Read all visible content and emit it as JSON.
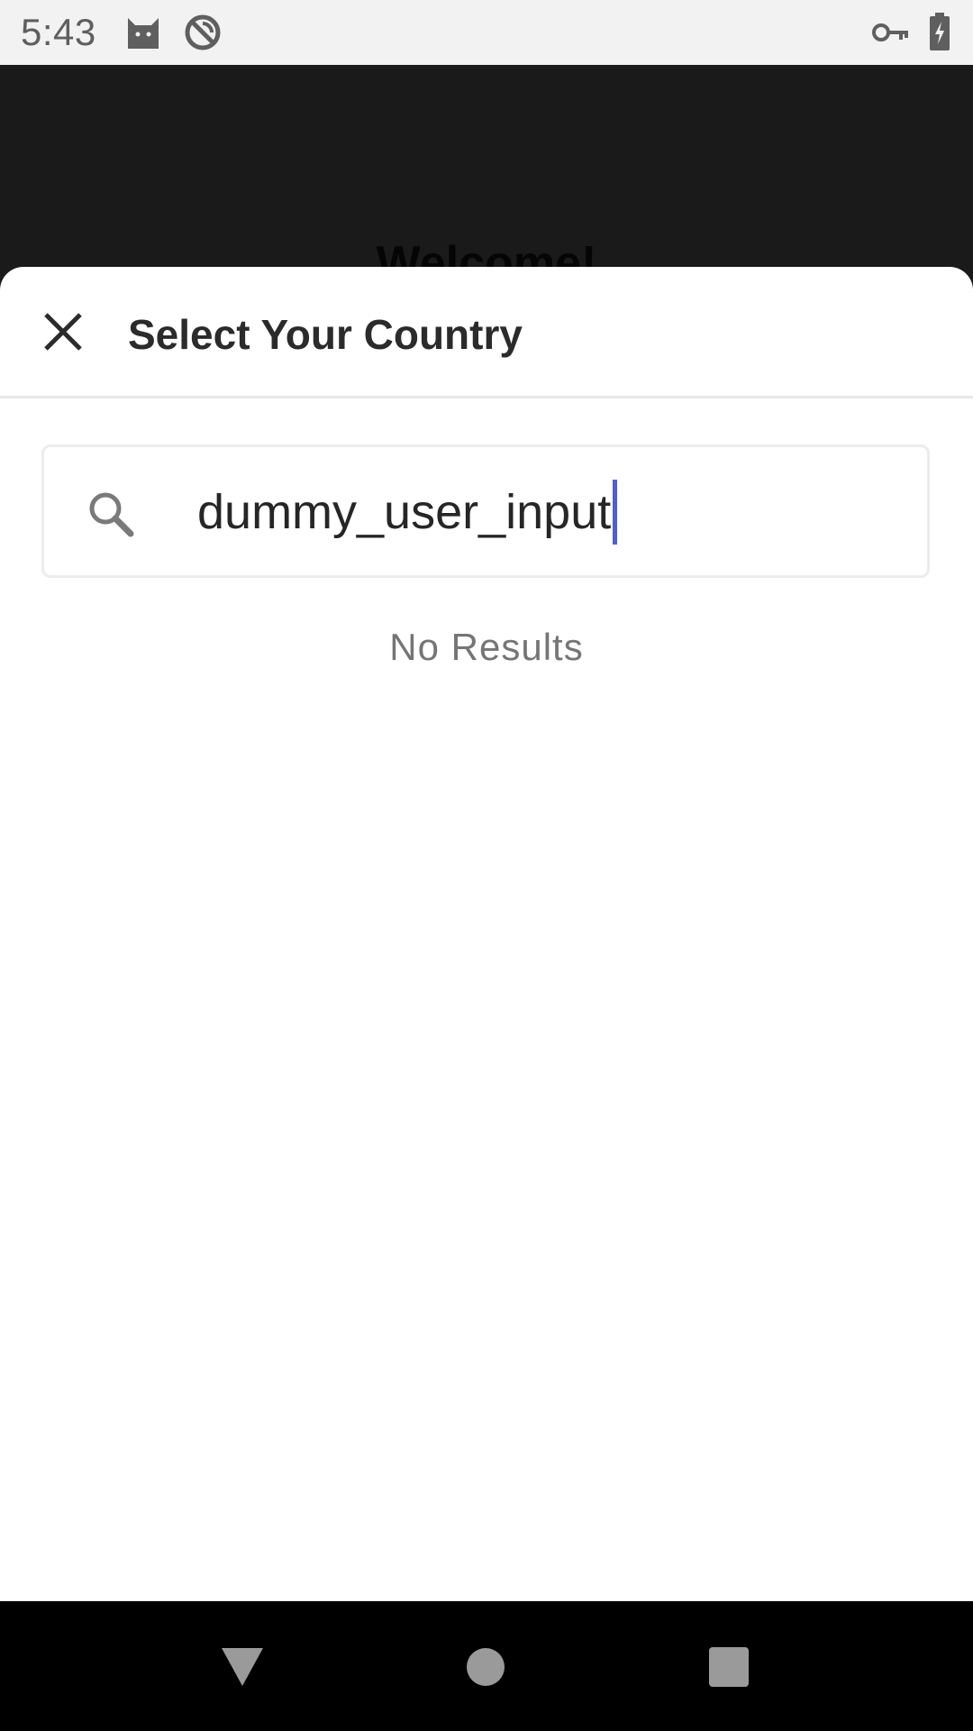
{
  "status_bar": {
    "time": "5:43",
    "icons": [
      "cat-icon",
      "do-not-disturb-icon",
      "vpn-key-icon",
      "battery-charging-icon"
    ]
  },
  "background": {
    "title": "Welcome!"
  },
  "sheet": {
    "close_icon": "close-icon",
    "title": "Select Your Country",
    "search": {
      "icon": "search-icon",
      "value": "dummy_user_input"
    },
    "empty_message": "No Results"
  },
  "nav_bar": {
    "icons": [
      "back-icon",
      "home-icon",
      "recents-icon"
    ]
  },
  "colors": {
    "accent_caret": "#4d5fd1",
    "background_dark": "#1a1a1a",
    "status_bar": "#f2f2f2"
  }
}
